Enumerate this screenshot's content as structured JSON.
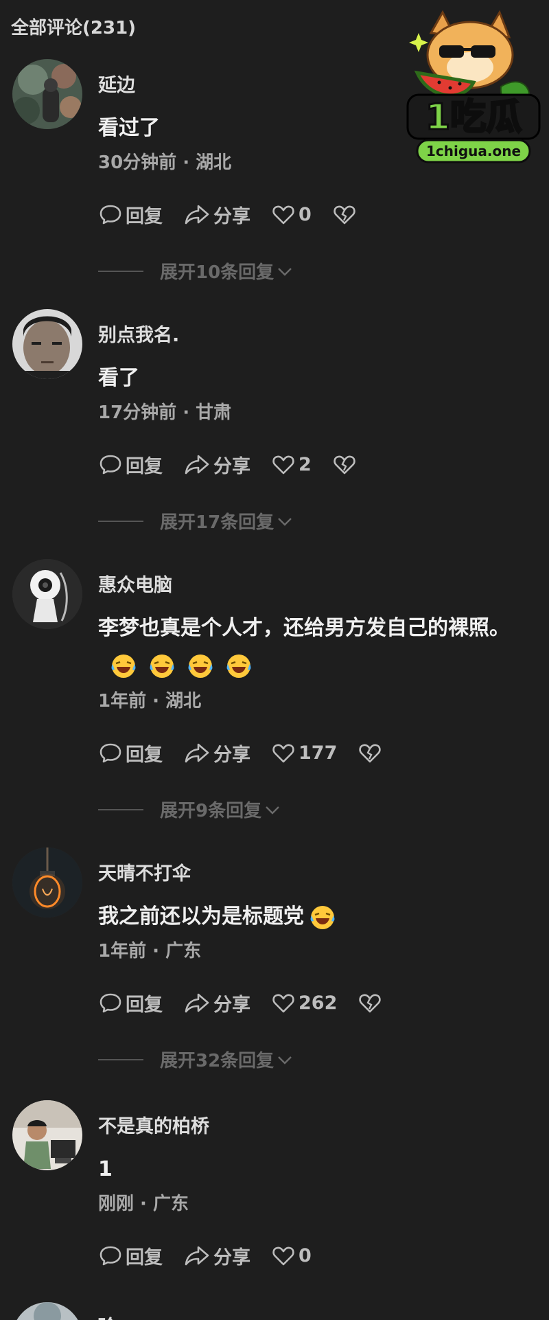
{
  "header": {
    "title": "全部评论(231)"
  },
  "logo": {
    "brand_text": "1吃瓜",
    "domain_text": "1chigua.one"
  },
  "actions": {
    "reply_label": "回复",
    "share_label": "分享"
  },
  "comments": [
    {
      "username": "延边",
      "text": "看过了",
      "time": "30分钟前",
      "location": "湖北",
      "meta": "30分钟前 · 湖北",
      "likes": "0",
      "expand": "展开10条回复"
    },
    {
      "username": "别点我名.",
      "text": "看了",
      "time": "17分钟前",
      "location": "甘肃",
      "meta": "17分钟前 · 甘肃",
      "likes": "2",
      "expand": "展开17条回复"
    },
    {
      "username": "惠众电脑",
      "text": "李梦也真是个人才，还给男方发自己的裸照。",
      "time": "1年前",
      "location": "湖北",
      "meta": "1年前 · 湖北",
      "likes": "177",
      "expand": "展开9条回复",
      "emoji": "laughing-crying-emoji"
    },
    {
      "username": "天晴不打伞",
      "text": "我之前还以为是标题党",
      "time": "1年前",
      "location": "广东",
      "meta": "1年前 · 广东",
      "likes": "262",
      "expand": "展开32条回复",
      "emoji": "laughing-crying-emoji"
    },
    {
      "username": "不是真的柏桥",
      "text": "1",
      "time": "刚刚",
      "location": "广东",
      "meta": "刚刚 · 广东",
      "likes": "0"
    },
    {
      "username": "玲"
    }
  ],
  "colors": {
    "background": "#1e1e1e",
    "text_primary": "#f0f0f0",
    "text_secondary": "#a9a9a9",
    "text_muted": "#6a6a6a",
    "logo_green": "#6dc23a"
  }
}
